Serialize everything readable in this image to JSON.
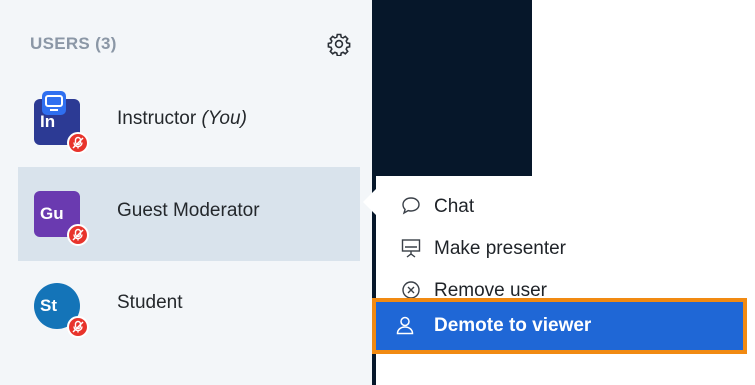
{
  "users_panel": {
    "title": "USERS (3)",
    "settings_icon": "gear-icon",
    "users": [
      {
        "initials": "In",
        "name": "Instructor",
        "suffix": "(You)",
        "color": "#2c3a94",
        "shape": "square",
        "presenter": true,
        "muted": true
      },
      {
        "initials": "Gu",
        "name": "Guest Moderator",
        "suffix": "",
        "color": "#6a3ab0",
        "shape": "square",
        "presenter": false,
        "muted": true,
        "selected": true
      },
      {
        "initials": "St",
        "name": "Student",
        "suffix": "",
        "color": "#1474b8",
        "shape": "circle",
        "presenter": false,
        "muted": true
      }
    ]
  },
  "context_menu": {
    "items": [
      {
        "label": "Chat",
        "icon": "chat-bubble-icon"
      },
      {
        "label": "Make presenter",
        "icon": "presentation-board-icon"
      },
      {
        "label": "Remove user",
        "icon": "remove-circle-icon"
      },
      {
        "label": "Demote to viewer",
        "icon": "user-icon",
        "highlighted": true
      }
    ]
  },
  "colors": {
    "sidebar_bg": "#f3f6f9",
    "selected_row_bg": "#d9e3ec",
    "dark_panel_bg": "#06172a",
    "menu_highlight": "#1f67d6",
    "annotation_outline": "#f18a12",
    "mute_badge": "#e8342c"
  }
}
